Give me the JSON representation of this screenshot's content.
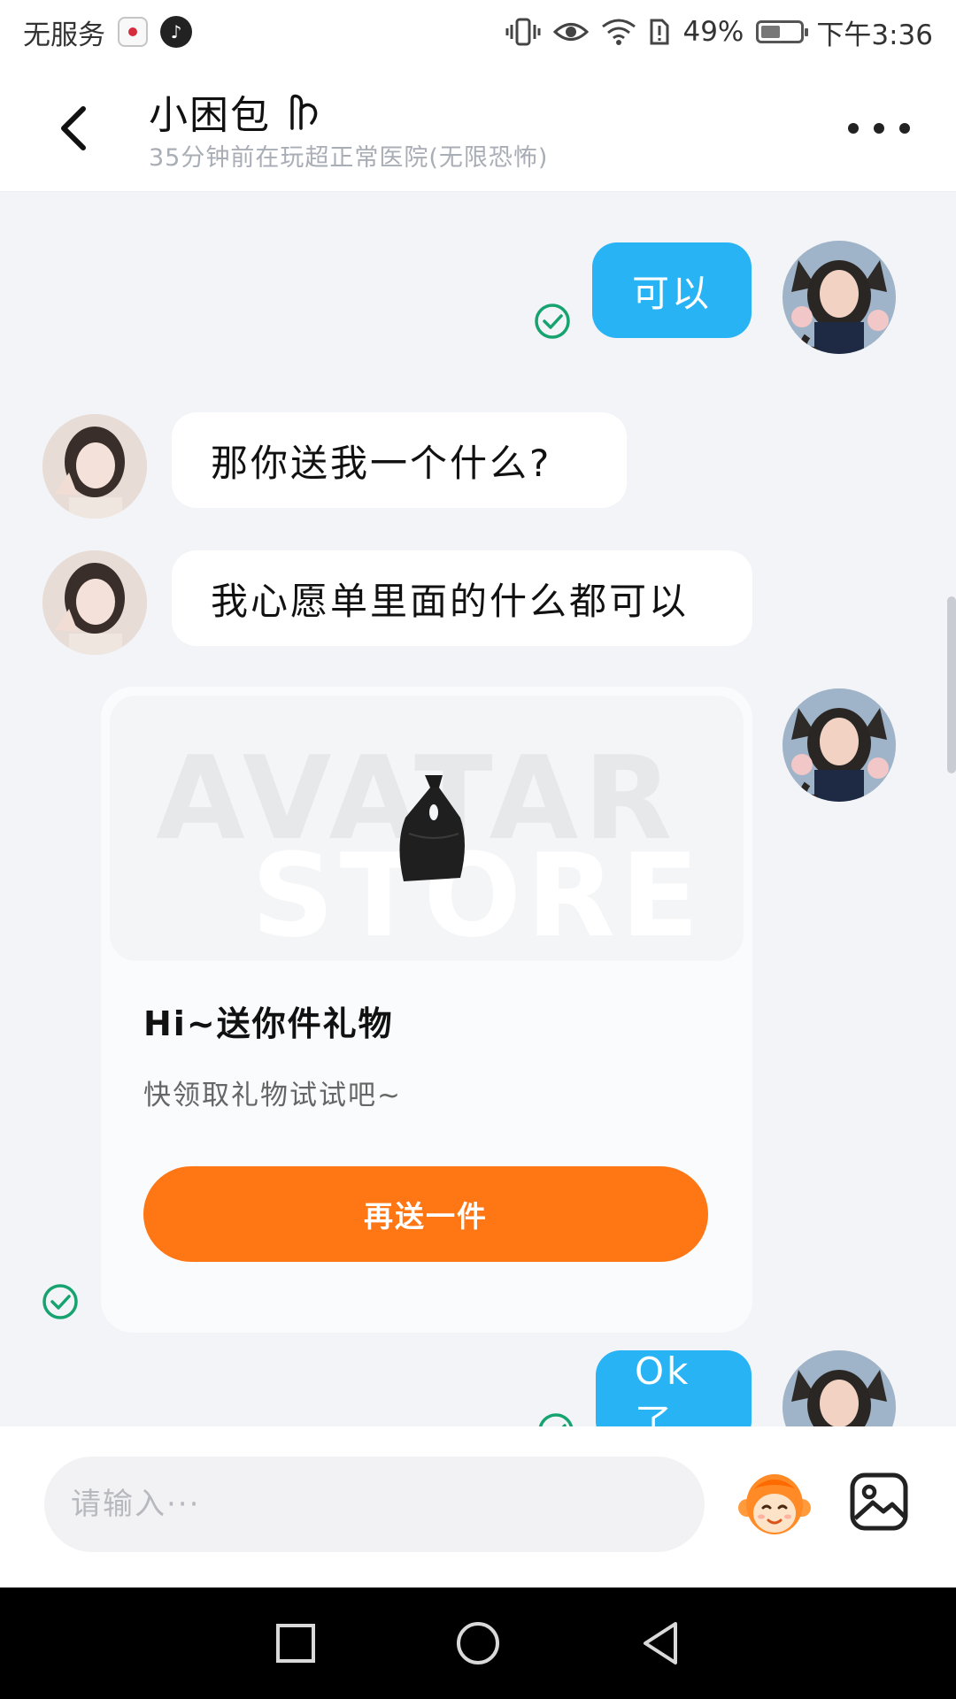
{
  "status_bar": {
    "carrier": "无服务",
    "battery": "49%",
    "battery_level": 0.49,
    "time": "下午3:36"
  },
  "header": {
    "title": "小困包",
    "subtitle": "35分钟前在玩超正常医院(无限恐怖)"
  },
  "messages": [
    {
      "side": "out",
      "text": "可以",
      "status": "read"
    },
    {
      "side": "in",
      "text": "那你送我一个什么?"
    },
    {
      "side": "in",
      "text": "我心愿单里面的什么都可以"
    },
    {
      "side": "out",
      "type": "gift_card",
      "watermark": [
        "AVATAR",
        "STORE"
      ],
      "title": "Hi~送你件礼物",
      "subtitle": "快领取礼物试试吧~",
      "button": "再送一件",
      "status": "read"
    },
    {
      "side": "out",
      "text": "Ok了",
      "status": "read"
    }
  ],
  "input": {
    "placeholder": "请输入···"
  },
  "colors": {
    "outgoing_bubble": "#28b3f5",
    "gift_button": "#ff7614",
    "read_check": "#17a36f",
    "background": "#f2f4f8"
  }
}
